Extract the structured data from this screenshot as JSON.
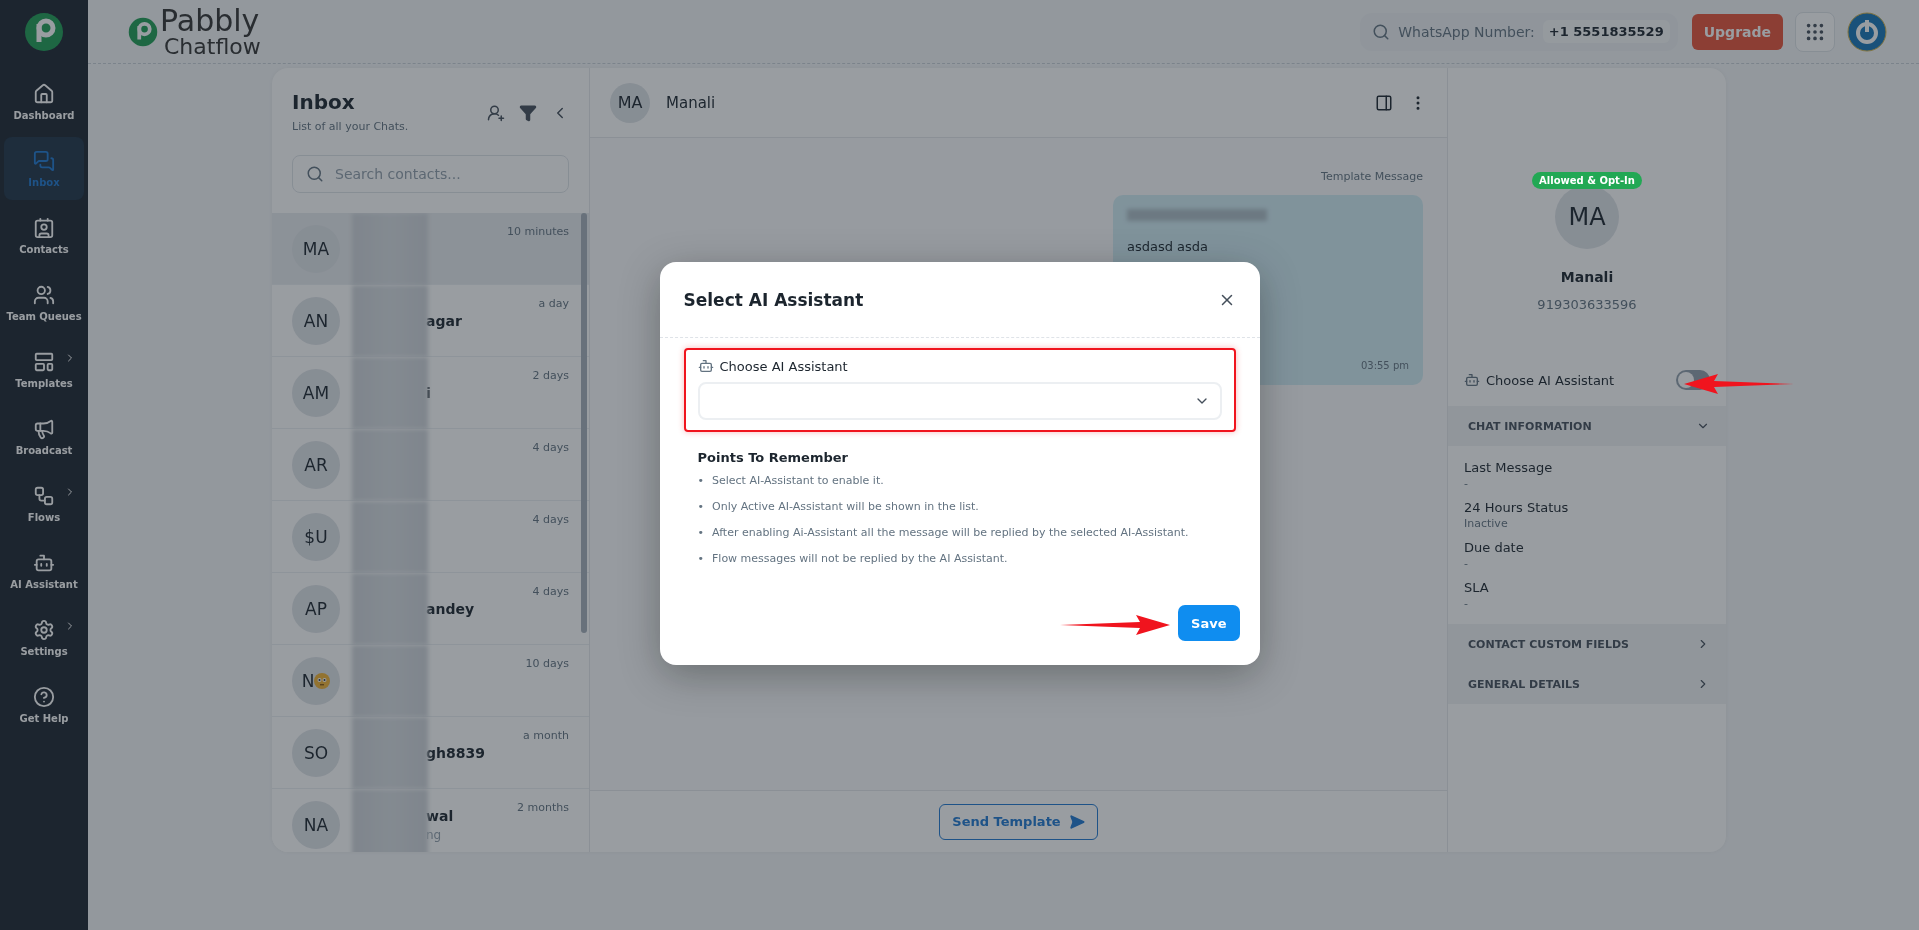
{
  "brand": {
    "name": "Pabbly",
    "sub": "Chatflow"
  },
  "header": {
    "whatsapp_label": "WhatsApp Number:",
    "whatsapp_number": "+1 5551835529",
    "upgrade": "Upgrade"
  },
  "nav": [
    {
      "label": "Dashboard",
      "selected": false,
      "submenu": false
    },
    {
      "label": "Inbox",
      "selected": true,
      "submenu": false
    },
    {
      "label": "Contacts",
      "selected": false,
      "submenu": false
    },
    {
      "label": "Team Queues",
      "selected": false,
      "submenu": false
    },
    {
      "label": "Templates",
      "selected": false,
      "submenu": true
    },
    {
      "label": "Broadcast",
      "selected": false,
      "submenu": false
    },
    {
      "label": "Flows",
      "selected": false,
      "submenu": true
    },
    {
      "label": "AI Assistant",
      "selected": false,
      "submenu": false
    },
    {
      "label": "Settings",
      "selected": false,
      "submenu": true
    },
    {
      "label": "Get Help",
      "selected": false,
      "submenu": false
    }
  ],
  "inbox": {
    "title": "Inbox",
    "subtitle": "List of all your Chats.",
    "search_placeholder": "Search contacts...",
    "chats": [
      {
        "initials": "MA",
        "time": "10 minutes",
        "selected": true,
        "emoji": false
      },
      {
        "initials": "AN",
        "name": "agar",
        "time": "a day",
        "selected": false,
        "emoji": false
      },
      {
        "initials": "AM",
        "name": "i",
        "time": "2 days",
        "selected": false,
        "emoji": false
      },
      {
        "initials": "AR",
        "time": "4 days",
        "selected": false,
        "emoji": false
      },
      {
        "initials": "$U",
        "time": "4 days",
        "selected": false,
        "emoji": false
      },
      {
        "initials": "AP",
        "name": "andey",
        "time": "4 days",
        "selected": false,
        "emoji": false
      },
      {
        "initials": "N",
        "time": "10 days",
        "selected": false,
        "emoji": true
      },
      {
        "initials": "SO",
        "name": "gh8839",
        "time": "a month",
        "selected": false,
        "emoji": false
      },
      {
        "initials": "NA",
        "name": "wal",
        "preview": "ng",
        "time": "2 months",
        "selected": false,
        "emoji": false
      }
    ]
  },
  "chat": {
    "initials": "MA",
    "name": "Manali",
    "template_label": "Template Message",
    "bubble_text": "asdasd asda",
    "time": "03:55 pm",
    "send_button": "Send Template"
  },
  "contact": {
    "badge": "Allowed & Opt-In",
    "initials": "MA",
    "name": "Manali",
    "phone": "919303633596",
    "ai_label": "Choose AI Assistant",
    "ai_on": false,
    "sections": [
      {
        "title": "CHAT INFORMATION",
        "expanded": true,
        "fields": [
          {
            "label": "Last Message",
            "value": "-"
          },
          {
            "label": "24 Hours Status",
            "value": "Inactive"
          },
          {
            "label": "Due date",
            "value": "-"
          },
          {
            "label": "SLA",
            "value": "-"
          }
        ]
      },
      {
        "title": "CONTACT CUSTOM FIELDS",
        "expanded": false
      },
      {
        "title": "GENERAL DETAILS",
        "expanded": false
      }
    ]
  },
  "modal": {
    "title": "Select AI Assistant",
    "field_label": "Choose AI Assistant",
    "points_title": "Points To Remember",
    "points": [
      {
        "marker": "•",
        "text": "Select AI-Assistant to enable it."
      },
      {
        "marker": "•",
        "text": "Only Active AI-Assistant will be shown in the list."
      },
      {
        "marker": "•",
        "text": "After enabling Ai-Assistant all the message will be replied by the selected AI-Assistant."
      },
      {
        "marker": "•",
        "text": "Flow messages will not be replied by the AI Assistant."
      }
    ],
    "save": "Save"
  }
}
